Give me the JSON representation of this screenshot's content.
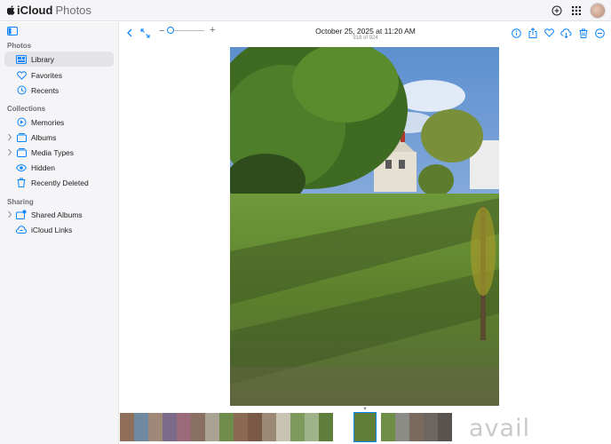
{
  "app": {
    "brand_bold": "iCloud",
    "brand_light": "Photos"
  },
  "sidebar": {
    "sections": {
      "photos": "Photos",
      "collections": "Collections",
      "sharing": "Sharing"
    },
    "items": [
      {
        "label": "Library",
        "icon": "library-icon",
        "selected": true
      },
      {
        "label": "Favorites",
        "icon": "heart-icon"
      },
      {
        "label": "Recents",
        "icon": "clock-icon"
      },
      {
        "label": "Memories",
        "icon": "memories-icon"
      },
      {
        "label": "Albums",
        "icon": "albums-icon"
      },
      {
        "label": "Media Types",
        "icon": "media-types-icon"
      },
      {
        "label": "Hidden",
        "icon": "eye-icon"
      },
      {
        "label": "Recently Deleted",
        "icon": "trash-icon"
      },
      {
        "label": "Shared Albums",
        "icon": "shared-albums-icon"
      },
      {
        "label": "iCloud Links",
        "icon": "cloud-link-icon"
      }
    ]
  },
  "viewer": {
    "title": "October 25, 2025 at 11:20 AM",
    "subtitle": "918 of 924",
    "zoom_minus": "−",
    "zoom_plus": "+",
    "zoom_level": 0
  },
  "watermark": "avail",
  "colors": {
    "accent": "#0a84ff",
    "sidebar_bg": "#f5f5f7",
    "selected_bg": "#e3e3e8"
  }
}
